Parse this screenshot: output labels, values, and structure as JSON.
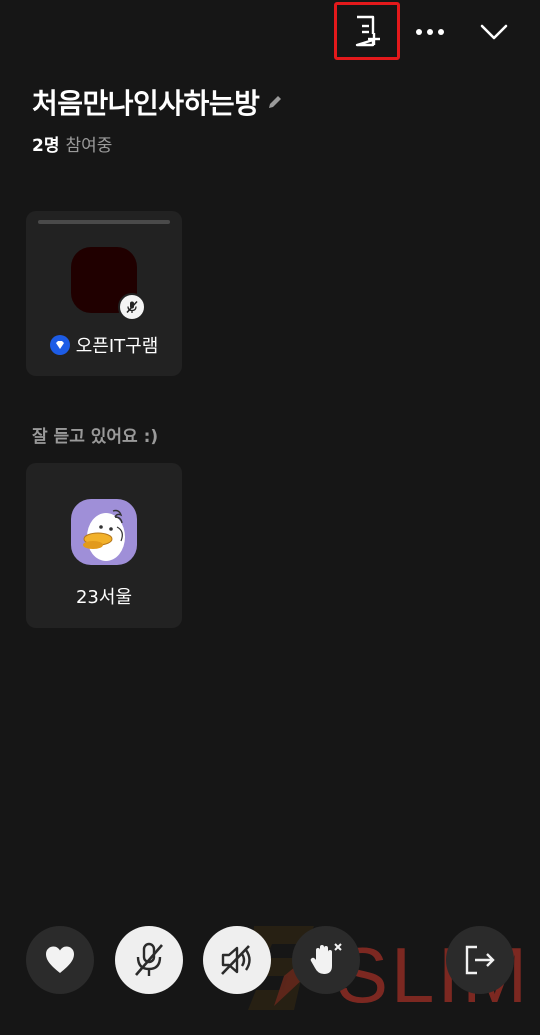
{
  "topbar": {
    "note_icon": "note-add-icon",
    "more_icon": "more-horizontal-icon",
    "collapse_icon": "chevron-down-icon",
    "highlight_color": "#e3191b"
  },
  "room": {
    "title": "처음만나인사하는방",
    "participant_count": "2명",
    "participant_suffix": "참여중"
  },
  "speakers": [
    {
      "name": "오픈IT구램",
      "mic": "muted",
      "badge": "diamond-badge-icon"
    }
  ],
  "listeners_label": "잘 듣고 있어요 :)",
  "listeners": [
    {
      "name": "23서울"
    }
  ],
  "controls": {
    "heart": "heart-icon",
    "mic": "mic-off-icon",
    "speaker": "speaker-off-icon",
    "hand": "raise-hand-icon",
    "exit": "exit-icon"
  },
  "watermark": {
    "text": "SLIM"
  },
  "colors": {
    "background": "#161616",
    "card": "#222222",
    "accent_blue": "#1d5ce6"
  }
}
